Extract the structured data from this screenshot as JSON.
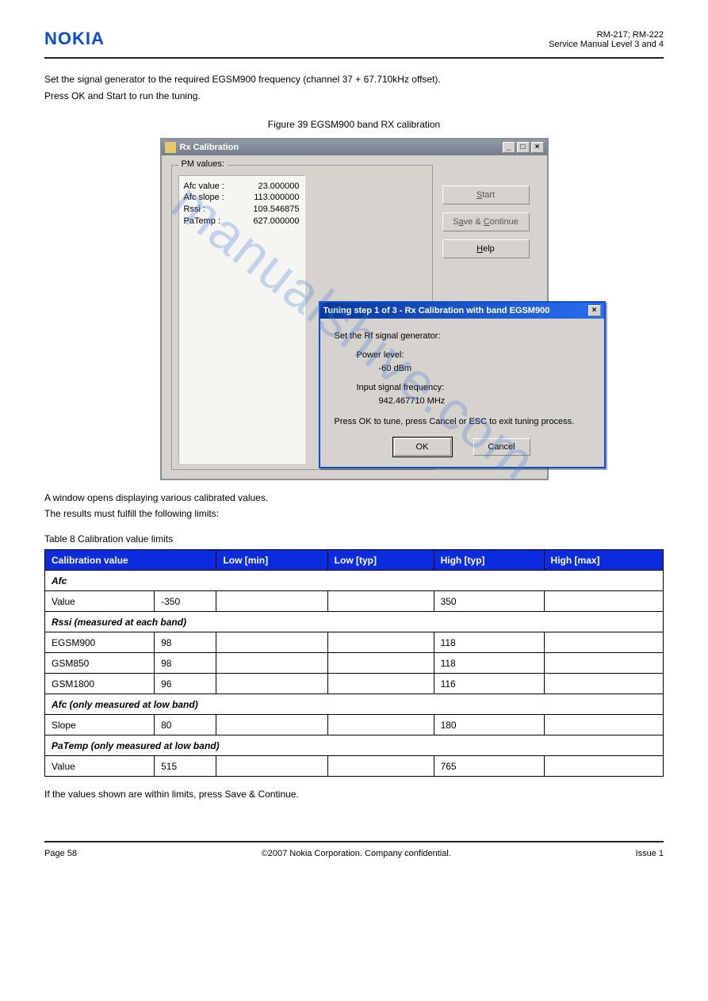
{
  "header": {
    "logo": "NOKIA",
    "right": "RM-217; RM-222\nService Manual Level 3 and 4"
  },
  "intro": {
    "line1": "Set the signal generator to the required EGSM900 frequency (channel 37 + 67.710kHz offset).",
    "line2": "Press OK and Start to run the tuning."
  },
  "caption_fig": "Figure 39 EGSM900 band RX calibration",
  "window": {
    "title": "Rx Calibration",
    "pm_legend": "PM values:",
    "rows": [
      {
        "label": "Afc value :",
        "val": "23.000000"
      },
      {
        "label": "Afc slope :",
        "val": "113.000000"
      },
      {
        "label": "Rssi       :",
        "val": "109.546875"
      },
      {
        "label": "PaTemp  :",
        "val": "627.000000"
      }
    ],
    "buttons": {
      "start": "Start",
      "save": "Save & Continue",
      "help": "Help"
    },
    "win_min": "_",
    "win_max": "□",
    "win_close": "×"
  },
  "dialog": {
    "title": "Tuning step 1 of 3 - Rx Calibration with band EGSM900",
    "line1": "Set the Rf signal generator:",
    "pl_label": "Power level:",
    "pl_val": "-60 dBm",
    "freq_label": "Input signal frequency:",
    "freq_val": "942.467710 MHz",
    "instruction": "Press OK to tune, press Cancel or ESC to exit tuning process.",
    "ok": "OK",
    "cancel": "Cancel",
    "close": "×"
  },
  "after": {
    "p1": "A window opens displaying various calibrated values.",
    "p2": "The results must fulfill the following limits:"
  },
  "table_caption": "Table 8 Calibration value limits",
  "table": {
    "headers": [
      "Calibration value",
      "Low [min]",
      "Low [typ]",
      "High [typ]",
      "High [max]"
    ],
    "rows": [
      {
        "span": true,
        "text": "Afc"
      },
      {
        "cells": [
          "Value",
          "-350",
          "",
          "",
          "350"
        ]
      },
      {
        "span": true,
        "text": "Rssi (measured at each band)"
      },
      {
        "cells": [
          "EGSM900",
          "98",
          "",
          "",
          "118"
        ]
      },
      {
        "cells": [
          "GSM850",
          "98",
          "",
          "",
          "118"
        ]
      },
      {
        "cells": [
          "GSM1800",
          "96",
          "",
          "",
          "116"
        ]
      },
      {
        "span": true,
        "text": "Afc (only measured at low band)"
      },
      {
        "cells": [
          "Slope",
          "80",
          "",
          "",
          "180"
        ]
      },
      {
        "span": true,
        "text": "PaTemp (only measured at low band)"
      },
      {
        "cells": [
          "Value",
          "515",
          "",
          "",
          "765"
        ]
      }
    ]
  },
  "end_note": "If the values shown are within limits, press Save & Continue.",
  "footer": {
    "left": "Page 58",
    "center": "©2007 Nokia Corporation. Company confidential.",
    "right": "Issue 1"
  },
  "watermark": "manualshive.com"
}
